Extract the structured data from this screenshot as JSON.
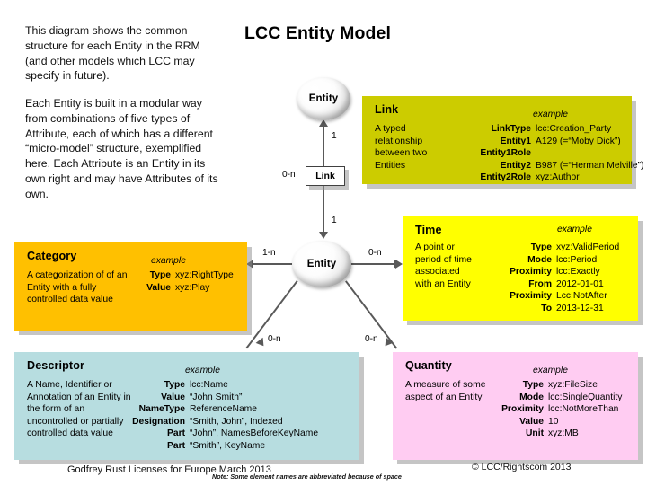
{
  "title": "LCC Entity Model",
  "intro": {
    "paragraph1": "This diagram shows the common structure for each Entity in the RRM (and other models which LCC may specify in future).",
    "paragraph2": "Each Entity is built in a modular way from combinations of five types of Attribute, each of which has a different “micro-model” structure, exemplified here. Each Attribute is an Entity in its own right and may have Attributes of its own."
  },
  "nodes": {
    "entity_top": "Entity",
    "entity_mid": "Entity",
    "link_node": "Link"
  },
  "cardinalities": {
    "link_to_entity_top": "1",
    "link_left": "0-n",
    "link_to_entity_mid": "1",
    "entity_to_category": "1-n",
    "entity_to_time": "0-n",
    "entity_to_descriptor": "0-n",
    "entity_to_quantity": "0-n"
  },
  "example_label": "example",
  "cards": {
    "link": {
      "title": "Link",
      "description": "A typed relationship between two Entities",
      "color": "#cccc00",
      "rows": [
        {
          "key": "LinkType",
          "value": "lcc:Creation_Party"
        },
        {
          "key": "Entity1",
          "value": "A129 (=“Moby Dick”)"
        },
        {
          "key": "Entity1Role",
          "value": ""
        },
        {
          "key": "Entity2",
          "value": "B987 (=“Herman Melville”)"
        },
        {
          "key": "Entity2Role",
          "value": "xyz:Author"
        }
      ]
    },
    "time": {
      "title": "Time",
      "description": "A point or period of time associated with an Entity",
      "color": "#ffff00",
      "rows": [
        {
          "key": "Type",
          "value": "xyz:ValidPeriod"
        },
        {
          "key": "Mode",
          "value": "lcc:Period"
        },
        {
          "key": "Proximity",
          "value": "lcc:Exactly"
        },
        {
          "key": "From",
          "value": "2012-01-01"
        },
        {
          "key": "Proximity",
          "value": "Lcc:NotAfter"
        },
        {
          "key": "To",
          "value": "2013-12-31"
        }
      ]
    },
    "category": {
      "title": "Category",
      "description": "A categorization of of an Entity with a fully controlled data value",
      "color": "#ffc000",
      "rows": [
        {
          "key": "Type",
          "value": "xyz:RightType"
        },
        {
          "key": "Value",
          "value": "xyz:Play"
        }
      ]
    },
    "descriptor": {
      "title": "Descriptor",
      "description": "A Name, Identifier or Annotation of an Entity in the form of an uncontrolled or partially controlled data value",
      "color": "#b7dde0",
      "rows": [
        {
          "key": "Type",
          "value": "lcc:Name"
        },
        {
          "key": "Value",
          "value": "“John Smith”"
        },
        {
          "key": "NameType",
          "value": "ReferenceName"
        },
        {
          "key": "Designation",
          "value": "“Smith, John”, Indexed"
        },
        {
          "key": "Part",
          "value": "“John”, NamesBeforeKeyName"
        },
        {
          "key": "Part",
          "value": "“Smith”, KeyName"
        }
      ]
    },
    "quantity": {
      "title": "Quantity",
      "description": "A measure of some aspect of an Entity",
      "color": "#ffccf2",
      "rows": [
        {
          "key": "Type",
          "value": "xyz:FileSize"
        },
        {
          "key": "Mode",
          "value": "lcc:SingleQuantity"
        },
        {
          "key": "Proximity",
          "value": "lcc:NotMoreThan"
        },
        {
          "key": "Value",
          "value": "10"
        },
        {
          "key": "Unit",
          "value": "xyz:MB"
        }
      ]
    }
  },
  "footer": {
    "left": "Godfrey Rust Licenses for Europe March 2013",
    "right": "© LCC/Rightscom 2013",
    "note": "Note: Some element names are abbreviated because of space"
  }
}
